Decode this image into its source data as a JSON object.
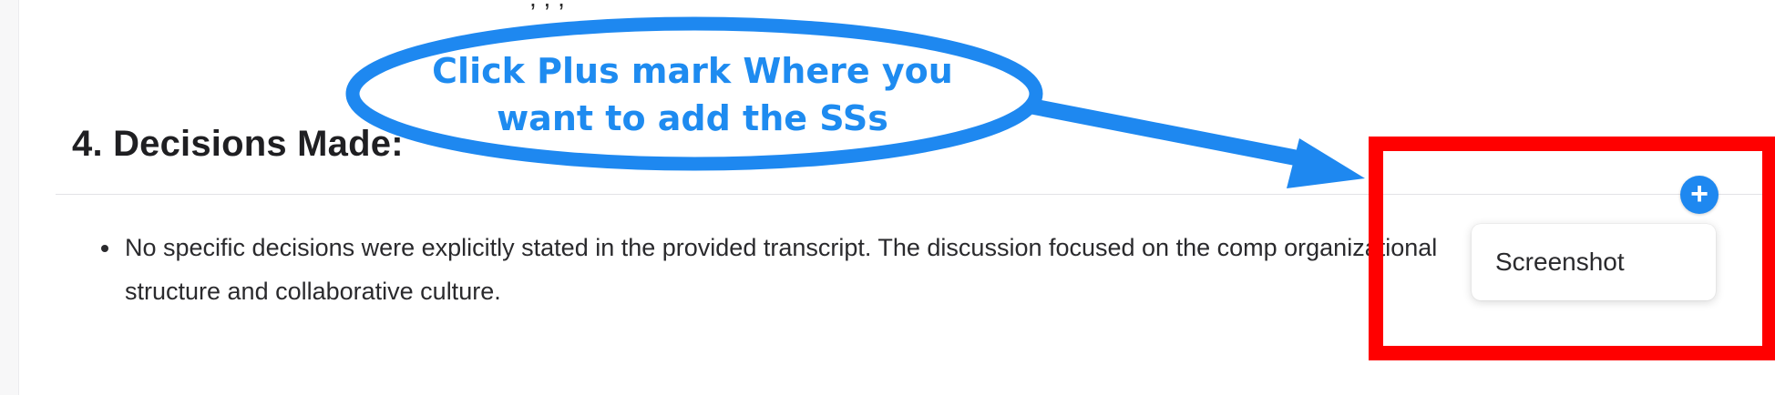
{
  "document": {
    "cut_off_text": ",  , ,",
    "section_title": "4. Decisions Made:",
    "bullets": [
      "No specific decisions were explicitly stated in the provided transcript. The discussion focused on the comp organizational structure and collaborative culture."
    ]
  },
  "insert_menu": {
    "plus_icon": "+",
    "items": [
      "Screenshot"
    ]
  },
  "annotation": {
    "callout_line1": "Click Plus mark Where you",
    "callout_line2": "want to add the SSs",
    "callout_color": "#1e8bf0",
    "highlight_color": "#ff0000"
  }
}
